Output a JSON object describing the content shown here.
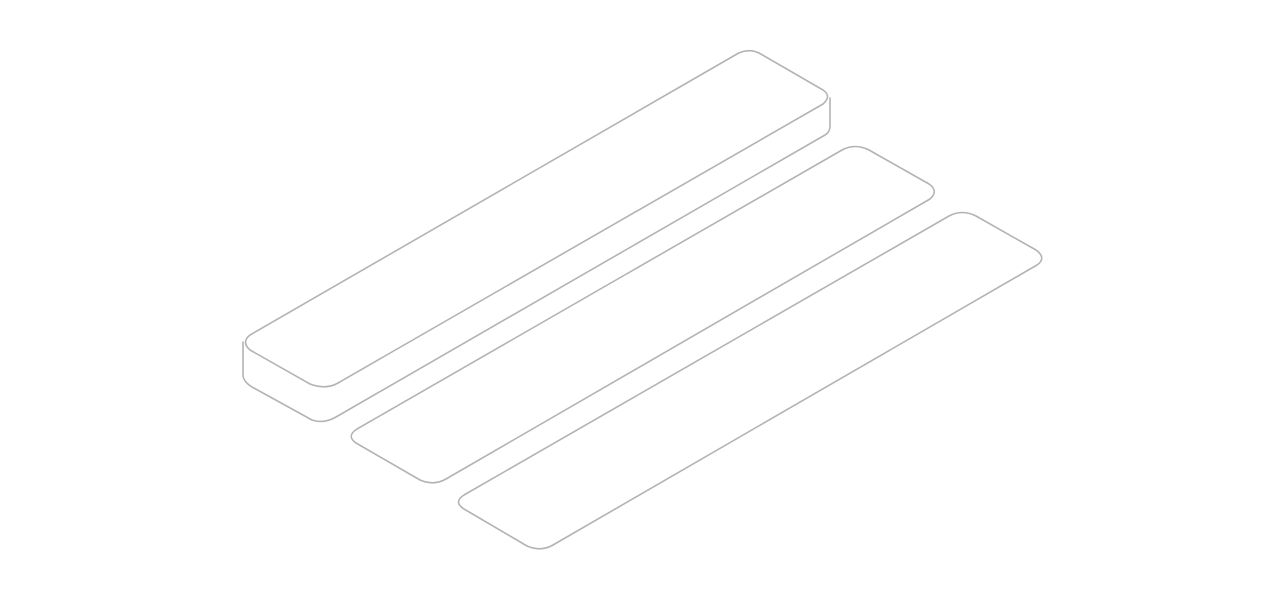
{
  "illustration": {
    "description_visible_text": "",
    "colors": {
      "background": "#ffffff",
      "stroke": "#b3b3b3"
    },
    "shapes": [
      {
        "id": "raised-bar",
        "kind": "isometric-bar-with-thickness"
      },
      {
        "id": "flat-bar-middle",
        "kind": "isometric-flat-rounded-rectangle"
      },
      {
        "id": "flat-bar-front",
        "kind": "isometric-flat-rounded-rectangle"
      }
    ]
  }
}
